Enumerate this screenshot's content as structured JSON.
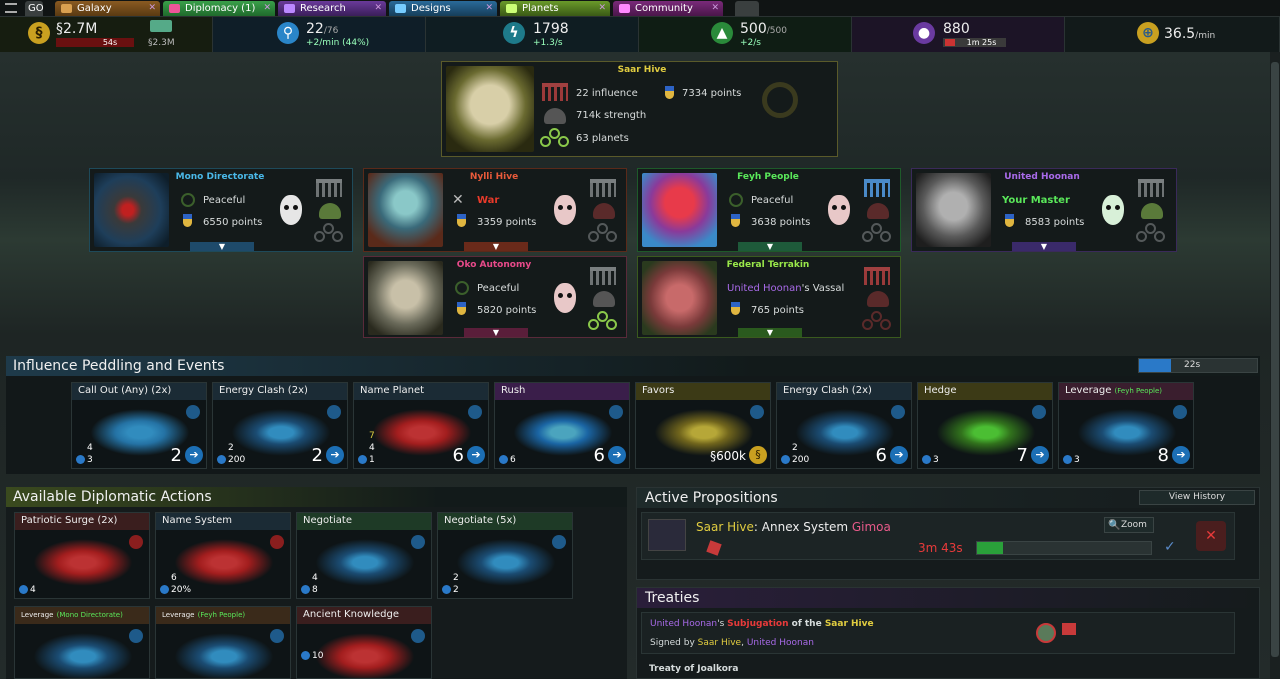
{
  "tabs": [
    {
      "label": "GO",
      "color": "#3a3f3f"
    },
    {
      "label": "Galaxy",
      "color": "#6b4a1e"
    },
    {
      "label": "Diplomacy (1)",
      "color": "#2f7a3c"
    },
    {
      "label": "Research",
      "color": "#4b2a6b"
    },
    {
      "label": "Designs",
      "color": "#1f4e6e"
    },
    {
      "label": "Planets",
      "color": "#4a6b1e"
    },
    {
      "label": "Community",
      "color": "#5a1e5a"
    }
  ],
  "resources": {
    "credits": {
      "value": "§2.7M",
      "timer": "54s",
      "sub": "§2.3M"
    },
    "influence": {
      "value": "22",
      "max": "/76",
      "sub": "+2/min (44%)"
    },
    "research": {
      "value": "1798",
      "sub": "+1.3/s"
    },
    "industry": {
      "value": "500",
      "max": "/500",
      "sub": "+2/s"
    },
    "dark": {
      "value": "880",
      "timer": "1m 25s"
    },
    "income": {
      "value": "36.5",
      "unit": "/min"
    }
  },
  "empires": {
    "saar": {
      "name": "Saar Hive",
      "influence": "22 influence",
      "strength": "714k strength",
      "planets": "63 planets",
      "points": "7334 points"
    },
    "mono": {
      "name": "Mono Directorate",
      "status": "Peaceful",
      "points": "6550 points"
    },
    "nylli": {
      "name": "Nylli Hive",
      "status": "War",
      "points": "3359 points"
    },
    "feyh": {
      "name": "Feyh People",
      "status": "Peaceful",
      "points": "3638 points"
    },
    "honoan": {
      "name": "United Hoonan",
      "status": "Your Master",
      "points": "8583 points"
    },
    "oko": {
      "name": "Oko Autonomy",
      "status": "Peaceful",
      "points": "5820 points"
    },
    "terrakin": {
      "name": "Federal Terrakin",
      "status_a": "United Hoonan",
      "status_b": "'s Vassal",
      "points": "765 points"
    }
  },
  "influence_section": {
    "title": "Influence Peddling and Events",
    "timer": "22s"
  },
  "influence_cards": [
    {
      "title": "Call Out (Any) (2x)",
      "cost": "2",
      "n1": "3",
      "n2": "4",
      "color": "#1b2b35"
    },
    {
      "title": "Energy Clash (2x)",
      "cost": "2",
      "n1": "200",
      "n2": "2",
      "color": "#1b2b35"
    },
    {
      "title": "Name Planet",
      "cost": "6",
      "n1": "1",
      "n2": "4",
      "n3": "7",
      "color": "#1b2b35"
    },
    {
      "title": "Rush",
      "cost": "6",
      "n1": "6",
      "color": "#3a1e4a"
    },
    {
      "title": "Favors",
      "cost": "§600k",
      "color": "#3c3a16"
    },
    {
      "title": "Energy Clash (2x)",
      "cost": "6",
      "n1": "200",
      "n2": "2",
      "color": "#1b2b35"
    },
    {
      "title": "Hedge",
      "cost": "7",
      "n1": "3",
      "color": "#3c3a16"
    },
    {
      "title": "Leverage",
      "title_b": "(Feyh People)",
      "cost": "8",
      "n1": "3",
      "color": "#3a1e2e"
    }
  ],
  "diplomatic": {
    "title": "Available Diplomatic Actions"
  },
  "dip_cards": [
    {
      "title": "Patriotic Surge (2x)",
      "n1": "4",
      "color": "#3a1e1e"
    },
    {
      "title": "Name System",
      "n1": "20%",
      "n2": "6",
      "color": "#1b2b35"
    },
    {
      "title": "Negotiate",
      "n1": "8",
      "n2": "4",
      "color": "#1e3a26"
    },
    {
      "title": "Negotiate (5x)",
      "n1": "2",
      "n2": "2",
      "color": "#1e3a26"
    },
    {
      "title": "Leverage",
      "title_b": "(Mono Directorate)",
      "color": "#3a2a1a"
    },
    {
      "title": "Leverage",
      "title_b": "(Feyh People)",
      "color": "#3a2a1a"
    },
    {
      "title": "Ancient Knowledge",
      "n1": "10",
      "color": "#3a1e1e"
    }
  ],
  "propositions": {
    "title": "Active Propositions",
    "history": "View History",
    "who": "Saar Hive",
    "action": ": Annex System ",
    "target": "Gimoa",
    "timer": "3m 43s",
    "zoom": "Zoom",
    "progress": 0.15
  },
  "treaties": {
    "title": "Treaties",
    "t1_a": "United Hoonan",
    "t1_b": "'s ",
    "t1_c": "Subjugation",
    "t1_d": " of the ",
    "t1_e": "Saar Hive",
    "signed": "Signed by ",
    "s_a": "Saar Hive",
    "s_sep": ", ",
    "s_b": "United Hoonan",
    "t2": "Treaty of Joalkora"
  }
}
